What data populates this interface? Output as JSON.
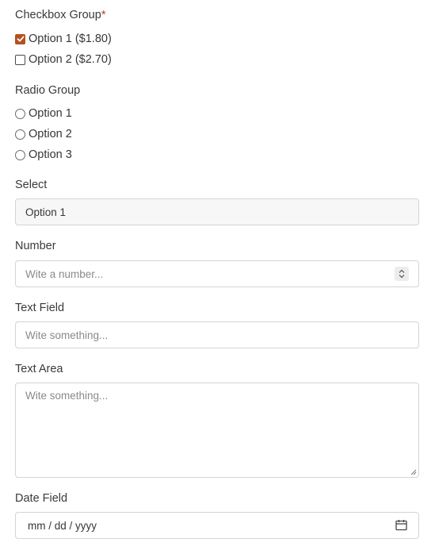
{
  "checkbox_group": {
    "label": "Checkbox Group",
    "required_mark": "*",
    "options": [
      {
        "label": "Option 1 ($1.80)",
        "checked": true
      },
      {
        "label": "Option 2 ($2.70)",
        "checked": false
      }
    ]
  },
  "radio_group": {
    "label": "Radio Group",
    "options": [
      {
        "label": "Option 1"
      },
      {
        "label": "Option 2"
      },
      {
        "label": "Option 3"
      }
    ]
  },
  "select": {
    "label": "Select",
    "value": "Option 1"
  },
  "number": {
    "label": "Number",
    "placeholder": "Wite a number..."
  },
  "text_field": {
    "label": "Text Field",
    "placeholder": "Wite something..."
  },
  "text_area": {
    "label": "Text Area",
    "placeholder": "Wite something..."
  },
  "date_field": {
    "label": "Date Field",
    "placeholder": "mm / dd / yyyy"
  },
  "colors": {
    "checkbox_accent": "#b5501f",
    "required": "#c0392b"
  },
  "icons": {
    "spinner": "chevron-up-down-icon",
    "calendar": "calendar-icon",
    "resize": "resize-grip-icon"
  }
}
